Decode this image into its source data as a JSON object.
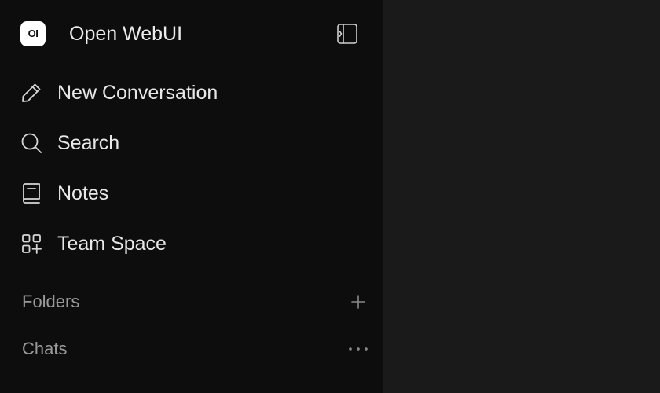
{
  "app": {
    "logo_text": "OI",
    "title": "Open WebUI",
    "toggle_icon": "sidebar-toggle-icon"
  },
  "nav": {
    "items": [
      {
        "label": "New Conversation",
        "icon": "pencil-icon"
      },
      {
        "label": "Search",
        "icon": "search-icon"
      },
      {
        "label": "Notes",
        "icon": "notebook-icon"
      },
      {
        "label": "Team Space",
        "icon": "grid-plus-icon"
      }
    ]
  },
  "sections": {
    "folders": {
      "label": "Folders",
      "action_icon": "plus-icon"
    },
    "chats": {
      "label": "Chats",
      "action_icon": "more-horizontal-icon"
    }
  },
  "colors": {
    "sidebar_bg": "#0d0d0d",
    "main_bg": "#1a1a1a",
    "text_primary": "#e8e8e8",
    "text_muted": "#9a9a9a"
  }
}
